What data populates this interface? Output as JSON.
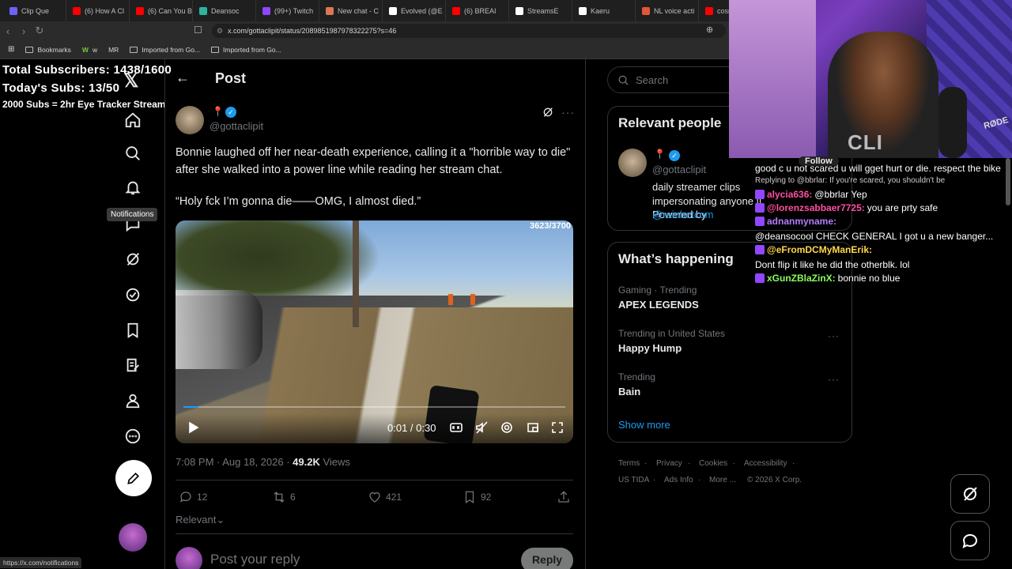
{
  "browser": {
    "tabs": [
      {
        "label": "Clip Que",
        "color": "#6c63ff"
      },
      {
        "label": "(6) How A Cl",
        "color": "#ff0000"
      },
      {
        "label": "(6) Can You B",
        "color": "#ff0000"
      },
      {
        "label": "Deansoc",
        "color": "#2bb5a0"
      },
      {
        "label": "(99+) Twitch",
        "color": "#9146ff"
      },
      {
        "label": "New chat - C",
        "color": "#d97757"
      },
      {
        "label": "Evolved (@E",
        "color": "#ffffff"
      },
      {
        "label": "(6) BREAI",
        "color": "#ff0000"
      },
      {
        "label": "StreamsE",
        "color": "#ffffff"
      },
      {
        "label": "Kaeru",
        "color": "#ffffff"
      },
      {
        "label": "NL voice acti",
        "color": "#e0563b"
      },
      {
        "label": "cosm",
        "color": "#ff0000"
      }
    ],
    "url": "x.com/gottaclipit/status/2089851987978322275?s=46",
    "bookmarks": [
      "Bookmarks",
      "w",
      "MR",
      "Imported from Go...",
      "Imported from Go..."
    ],
    "status_url": "https://x.com/notifications"
  },
  "overlay": {
    "total_subs": "Total Subscribers: 1438/1600",
    "today_subs": "Today's Subs: 13/50",
    "goal": "2000 Subs = 2hr Eye Tracker Stream"
  },
  "nav": {
    "tooltip": "Notifications",
    "icons": [
      "home-icon",
      "search-icon",
      "notifications-icon",
      "messages-icon",
      "grok-icon",
      "premium-icon",
      "bookmarks-icon",
      "articles-icon",
      "profile-icon",
      "more-icon"
    ]
  },
  "post": {
    "header_title": "Post",
    "handle": "@gottaclipit",
    "text": "Bonnie laughed off her near-death experience, calling it a \"horrible way to die\" after she walked into a power line while reading her stream chat.",
    "quote": "“Holy fck I’m gonna die——OMG, I almost died.”",
    "video_counter": "3623/3700",
    "video_time": "0:01 / 0:30",
    "timestamp": "7:08 PM · Aug 18, 2026 · ",
    "views_count": "49.2K",
    "views_label": " Views",
    "replies": "12",
    "reposts": "6",
    "likes": "421",
    "bookmarks": "92",
    "sort_label": "Relevant",
    "reply_placeholder": "Post your reply",
    "reply_button": "Reply"
  },
  "sidebar": {
    "search_placeholder": "Search",
    "relevant_title": "Relevant people",
    "person_handle": "@gottaclipit",
    "person_bio": "daily streamer clips impersonating anyone || Powered by",
    "person_link": "@rainbetcom",
    "follow_label": "Follow",
    "happening_title": "What’s happening",
    "trends": [
      {
        "category": "Gaming · Trending",
        "name": "APEX LEGENDS"
      },
      {
        "category": "Trending in United States",
        "name": "Happy Hump"
      },
      {
        "category": "Trending",
        "name": "Bain"
      }
    ],
    "show_more": "Show more",
    "footer1": [
      "Terms",
      "Privacy",
      "Cookies",
      "Accessibility"
    ],
    "footer2": [
      "US TIDA",
      "Ads Info",
      "More ...",
      "© 2026 X Corp."
    ]
  },
  "chat": {
    "partial": "good c   u   not scared u will gget hurt or die. respect the bike",
    "reply_ctx": "Replying to @bbrlar: If you're scared, you shouldn't be",
    "messages": [
      {
        "user": "alycia636:",
        "text": "@bbrlar Yep",
        "color": "#ff4fa0"
      },
      {
        "user": "@lorenzsabbaer7725:",
        "text": "you are prty safe",
        "color": "#ff4fa0"
      },
      {
        "user": "adnanmyname:",
        "text": "@deansocool CHECK GENERAL I got u a new banger...",
        "color": "#b57bff"
      },
      {
        "user": "@eFromDCMyManErik:",
        "text": "Dont flip it like he did the otherblk. lol",
        "color": "#ffd84a"
      },
      {
        "user": "xGunZBlaZinX:",
        "text": "bonnie no blue",
        "color": "#8aff5a"
      }
    ]
  }
}
